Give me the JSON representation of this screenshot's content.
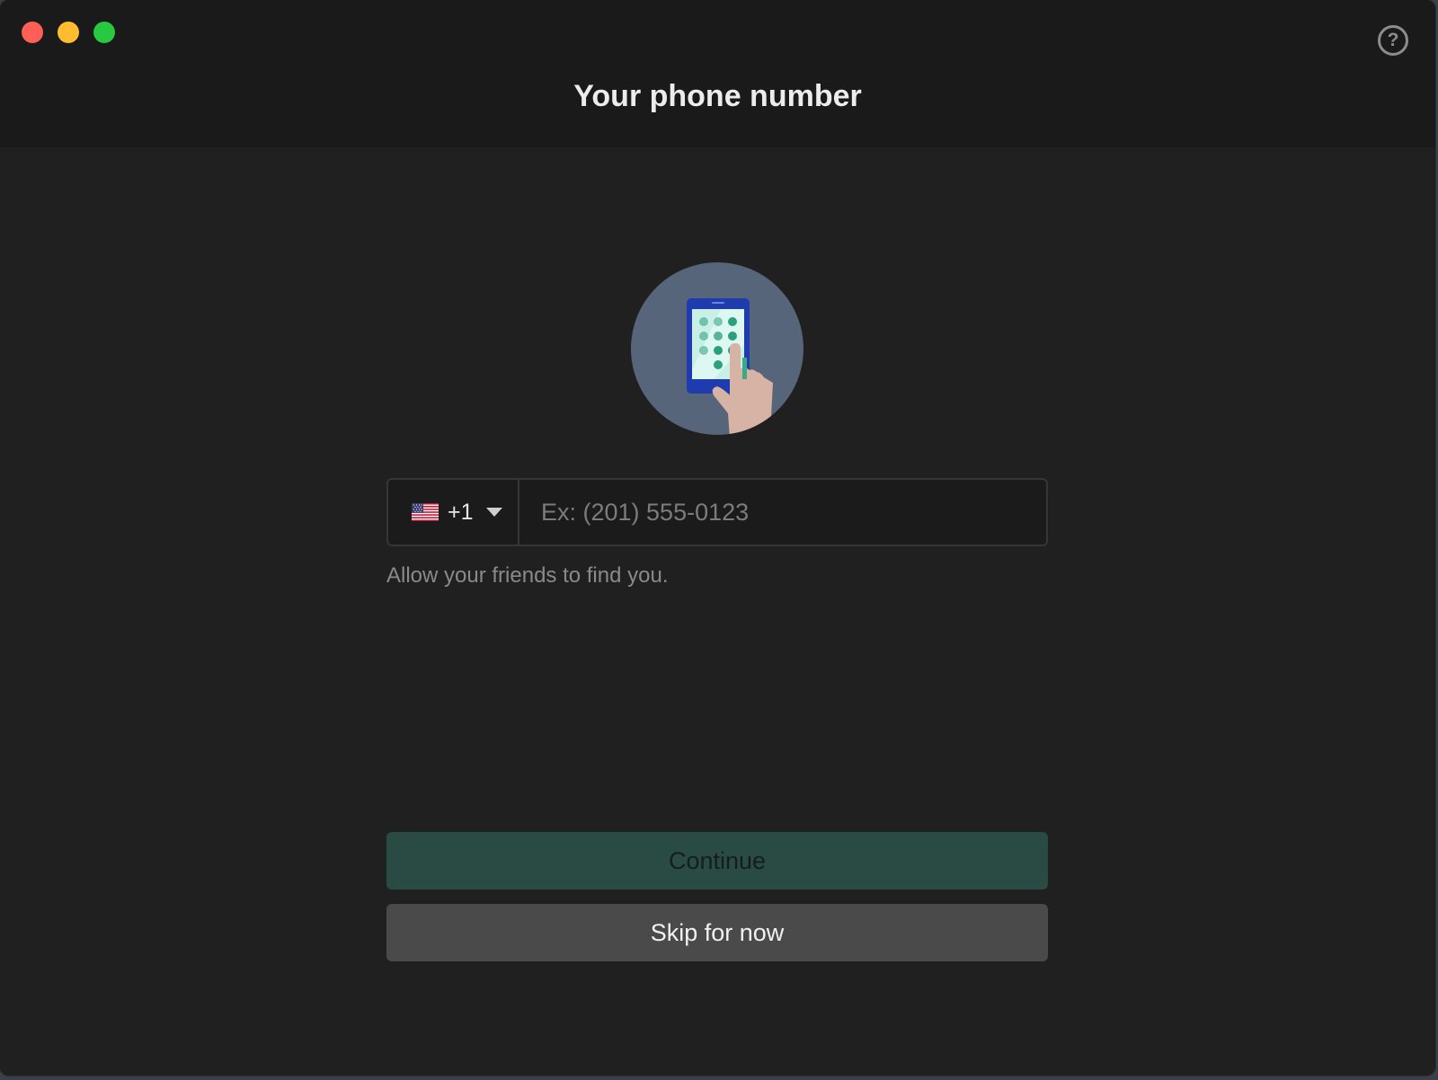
{
  "window": {
    "title": "Your phone number",
    "help_icon": "?"
  },
  "phone": {
    "country_flag": "us-flag",
    "country_code": "+1",
    "placeholder": "Ex: (201) 555-0123",
    "value": "",
    "hint": "Allow your friends to find you."
  },
  "actions": {
    "continue_label": "Continue",
    "skip_label": "Skip for now"
  },
  "colors": {
    "close": "#fe5f57",
    "minimize": "#febc2e",
    "maximize": "#28c840",
    "continue_bg": "#2a4b43",
    "skip_bg": "#4a4a4a"
  }
}
